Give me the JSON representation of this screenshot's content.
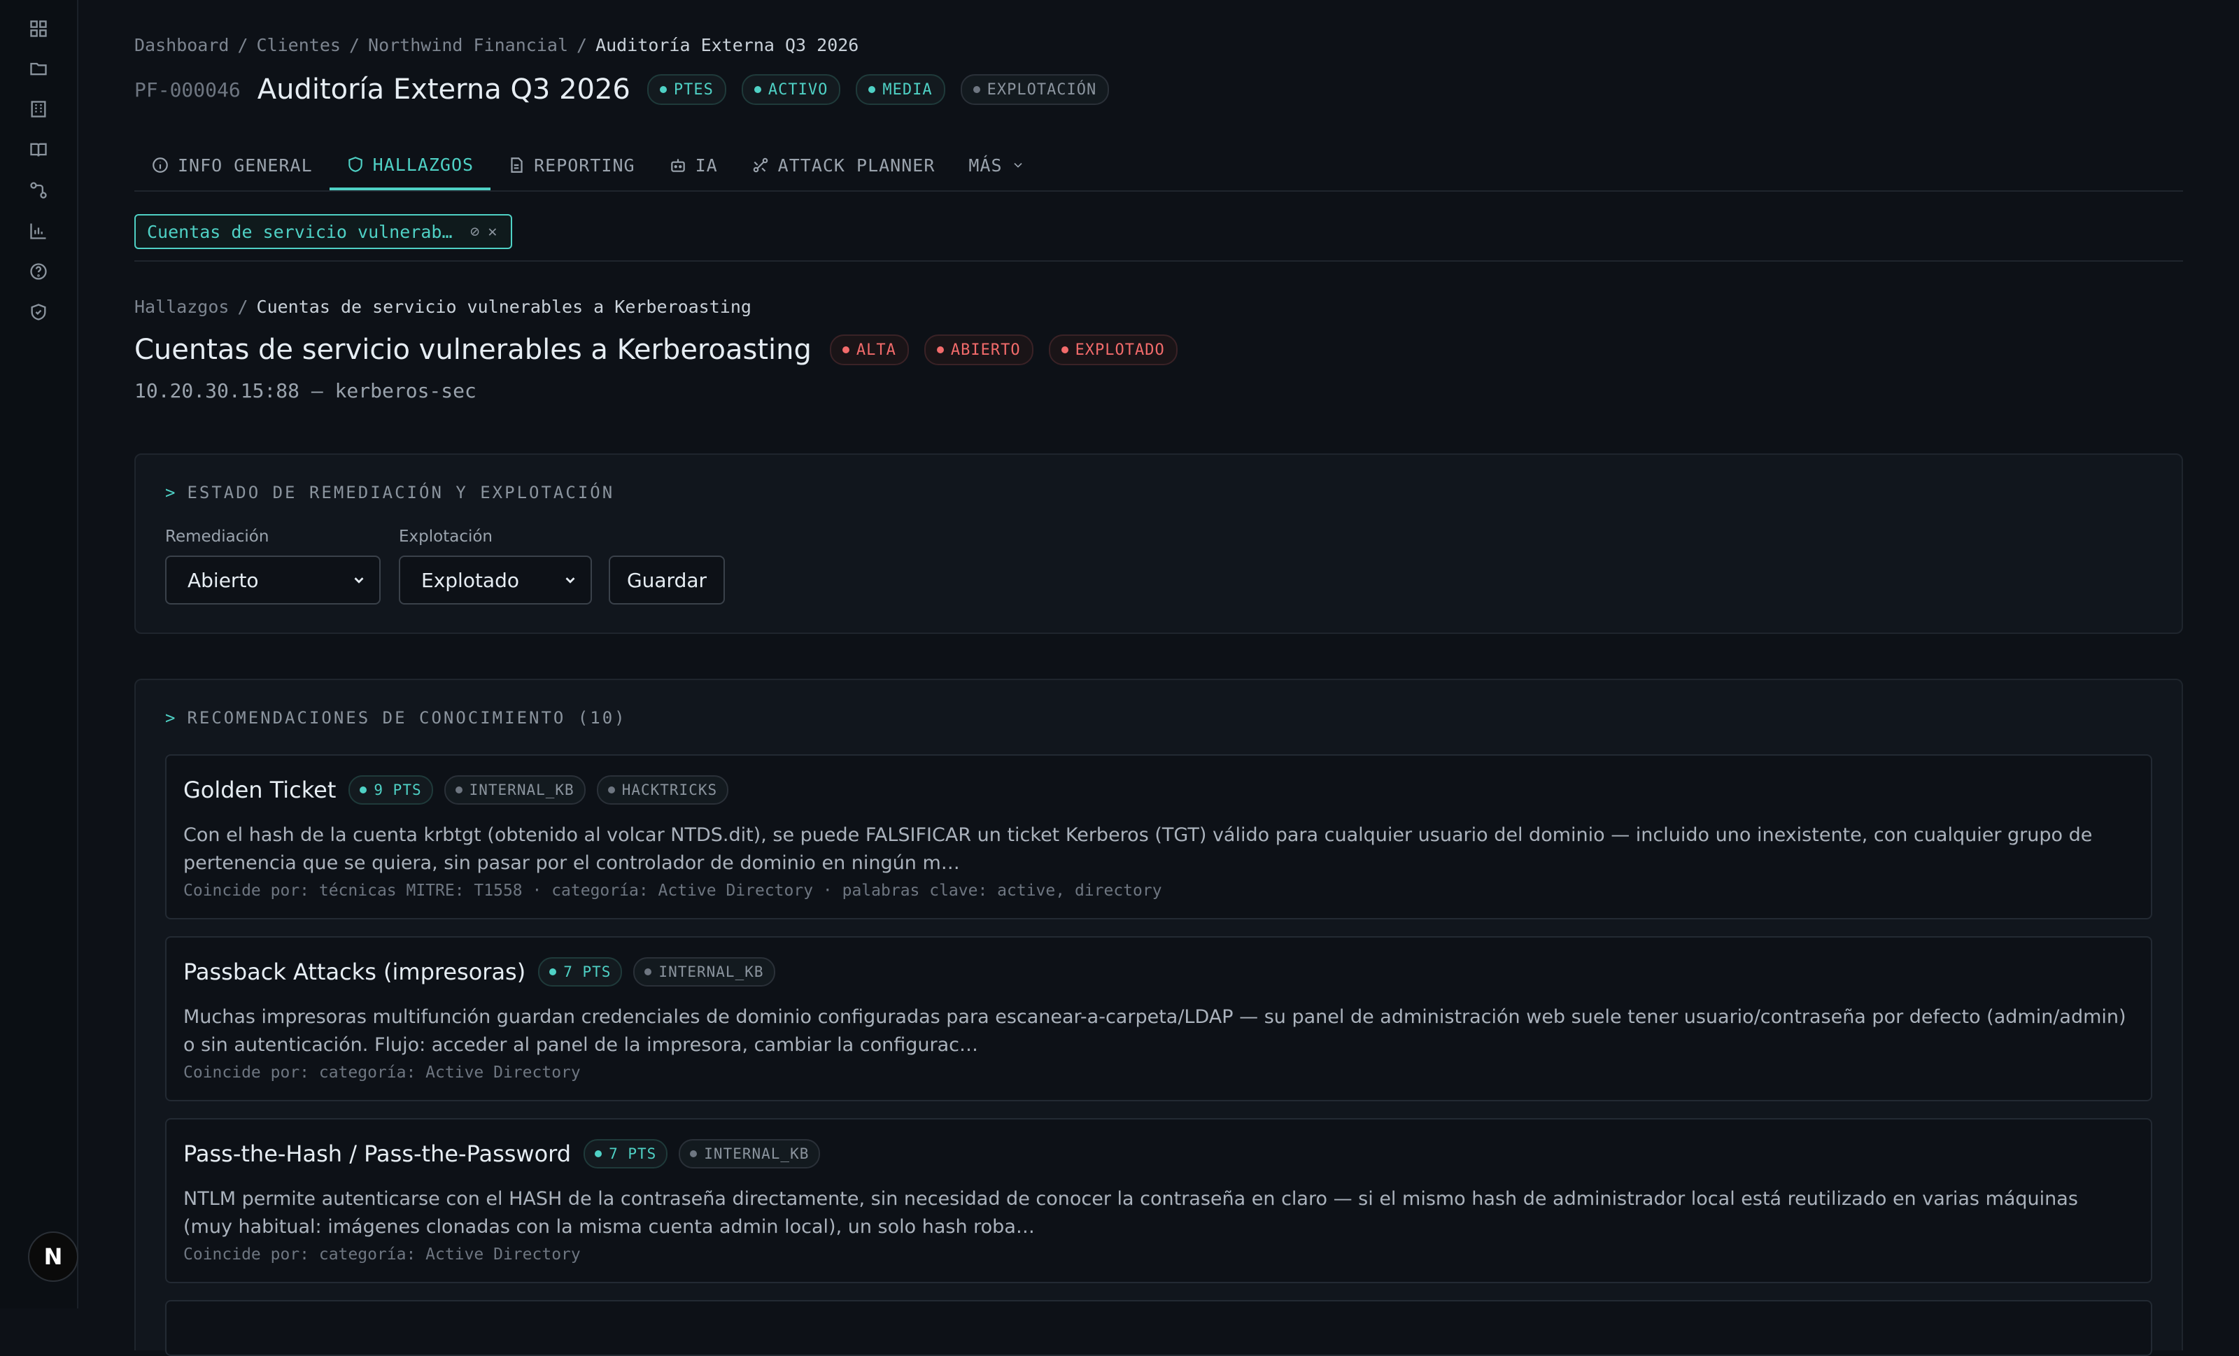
{
  "sidebar": {
    "icons": [
      "dashboard-icon",
      "folder-icon",
      "building-icon",
      "book-icon",
      "workflow-icon",
      "chart-icon",
      "help-icon",
      "shield-icon"
    ],
    "logo_letter": "N"
  },
  "breadcrumb": {
    "items": [
      "Dashboard",
      "Clientes",
      "Northwind Financial"
    ],
    "current": "Auditoría Externa Q3 2026",
    "separator": "/"
  },
  "project": {
    "code": "PF-000046",
    "title": "Auditoría Externa Q3 2026",
    "badges": [
      "PTES",
      "ACTIVO",
      "MEDIA",
      "EXPLOTACIÓN"
    ]
  },
  "tabs": [
    {
      "label": "INFO GENERAL",
      "icon": "info-icon"
    },
    {
      "label": "HALLAZGOS",
      "icon": "shield-icon",
      "active": true
    },
    {
      "label": "REPORTING",
      "icon": "document-icon"
    },
    {
      "label": "IA",
      "icon": "robot-icon"
    },
    {
      "label": "ATTACK PLANNER",
      "icon": "route-icon"
    },
    {
      "label": "MÁS",
      "icon": "chevron-down-icon"
    }
  ],
  "open_chip": {
    "label": "Cuentas de servicio vulnerable…"
  },
  "finding": {
    "breadcrumb_root": "Hallazgos",
    "breadcrumb_current": "Cuentas de servicio vulnerables a Kerberoasting",
    "title": "Cuentas de servicio vulnerables a Kerberoasting",
    "badges": [
      "ALTA",
      "ABIERTO",
      "EXPLOTADO"
    ],
    "host": "10.20.30.15:88 — kerberos-sec"
  },
  "status_panel": {
    "heading": "ESTADO DE REMEDIACIÓN Y EXPLOTACIÓN",
    "remediation_label": "Remediación",
    "remediation_value": "Abierto",
    "exploitation_label": "Explotación",
    "exploitation_value": "Explotado",
    "save_label": "Guardar"
  },
  "recommendations": {
    "heading": "RECOMENDACIONES DE CONOCIMIENTO (10)",
    "items": [
      {
        "name": "Golden Ticket",
        "points": "9 PTS",
        "sources": [
          "INTERNAL_KB",
          "HACKTRICKS"
        ],
        "description": "Con el hash de la cuenta krbtgt (obtenido al volcar NTDS.dit), se puede FALSIFICAR un ticket Kerberos (TGT) válido para cualquier usuario del dominio — incluido uno inexistente, con cualquier grupo de pertenencia que se quiera, sin pasar por el controlador de dominio en ningún m…",
        "match": "Coincide por: técnicas MITRE: T1558 · categoría: Active Directory · palabras clave: active, directory"
      },
      {
        "name": "Passback Attacks (impresoras)",
        "points": "7 PTS",
        "sources": [
          "INTERNAL_KB"
        ],
        "description": "Muchas impresoras multifunción guardan credenciales de dominio configuradas para escanear-a-carpeta/LDAP — su panel de administración web suele tener usuario/contraseña por defecto (admin/admin) o sin autenticación. Flujo: acceder al panel de la impresora, cambiar la configurac…",
        "match": "Coincide por: categoría: Active Directory"
      },
      {
        "name": "Pass-the-Hash / Pass-the-Password",
        "points": "7 PTS",
        "sources": [
          "INTERNAL_KB"
        ],
        "description": "NTLM permite autenticarse con el HASH de la contraseña directamente, sin necesidad de conocer la contraseña en claro — si el mismo hash de administrador local está reutilizado en varias máquinas (muy habitual: imágenes clonadas con la misma cuenta admin local), un solo hash roba…",
        "match": "Coincide por: categoría: Active Directory"
      }
    ]
  },
  "colors": {
    "background": "#0d1117",
    "accent": "#4fd1c5",
    "danger": "#f26b6b"
  }
}
